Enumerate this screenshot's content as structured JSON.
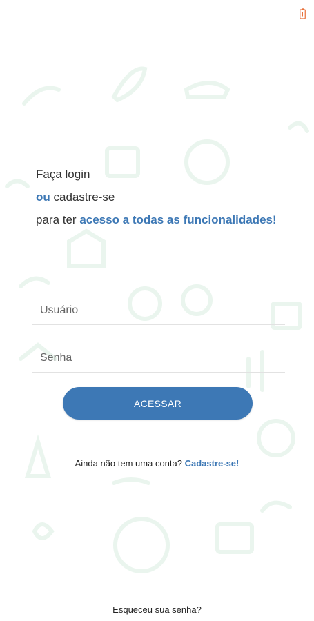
{
  "intro": {
    "line1": "Faça login",
    "line2_accent": "ou",
    "line2_rest": " cadastre-se",
    "line3_prefix": "para ter ",
    "line3_accent": "acesso a todas as funcionalidades!"
  },
  "form": {
    "username_placeholder": "Usuário",
    "password_placeholder": "Senha",
    "submit_label": "ACESSAR"
  },
  "signup": {
    "prompt": "Ainda não tem uma conta? ",
    "link": "Cadastre-se!"
  },
  "forgot_password": "Esqueceu sua senha?",
  "colors": {
    "accent": "#3d78b5",
    "background_pattern": "#eef7f1",
    "battery": "#e8703a"
  },
  "icons": {
    "status": "battery-icon",
    "background": "eco-pattern"
  }
}
